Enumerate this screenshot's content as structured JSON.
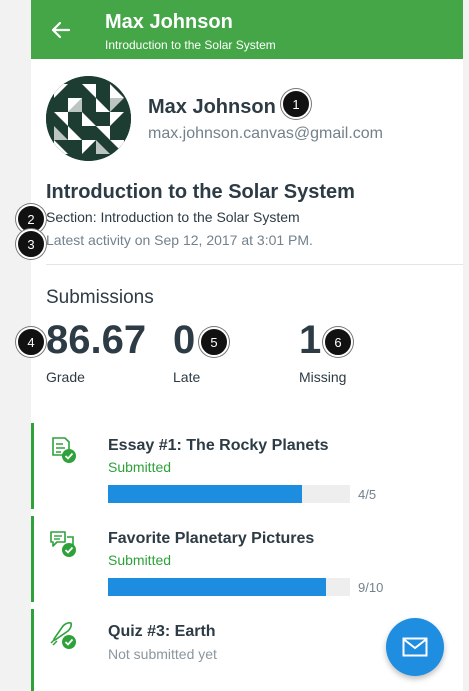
{
  "header": {
    "title": "Max Johnson",
    "subtitle": "Introduction to the Solar System",
    "color": "#44a647"
  },
  "student": {
    "name": "Max Johnson",
    "email": "max.johnson.canvas@gmail.com"
  },
  "course": {
    "title": "Introduction to the Solar System",
    "section": "Section: Introduction to the Solar System",
    "activity": "Latest activity on Sep 12, 2017 at 3:01 PM."
  },
  "submissions": {
    "heading": "Submissions",
    "stats": [
      {
        "value": "86.67",
        "label": "Grade"
      },
      {
        "value": "0",
        "label": "Late"
      },
      {
        "value": "1",
        "label": "Missing"
      }
    ]
  },
  "assignments": [
    {
      "title": "Essay #1: The Rocky Planets",
      "status": "Submitted",
      "score": "4/5",
      "progress": 0.8,
      "icon": "assignment-submitted-icon"
    },
    {
      "title": "Favorite Planetary Pictures",
      "status": "Submitted",
      "score": "9/10",
      "progress": 0.9,
      "icon": "discussion-submitted-icon"
    },
    {
      "title": "Quiz #3: Earth",
      "status": "Not submitted yet",
      "icon": "quiz-rocket-icon"
    }
  ],
  "colors": {
    "submitted": "#2ea13a",
    "not_submitted": "#8b969e",
    "progress": "#1d8ddf",
    "fab": "#1f8ee0"
  },
  "callouts": [
    "1",
    "2",
    "3",
    "4",
    "5",
    "6"
  ],
  "icons": {
    "back": "arrow-left-icon",
    "fab": "envelope-icon"
  }
}
